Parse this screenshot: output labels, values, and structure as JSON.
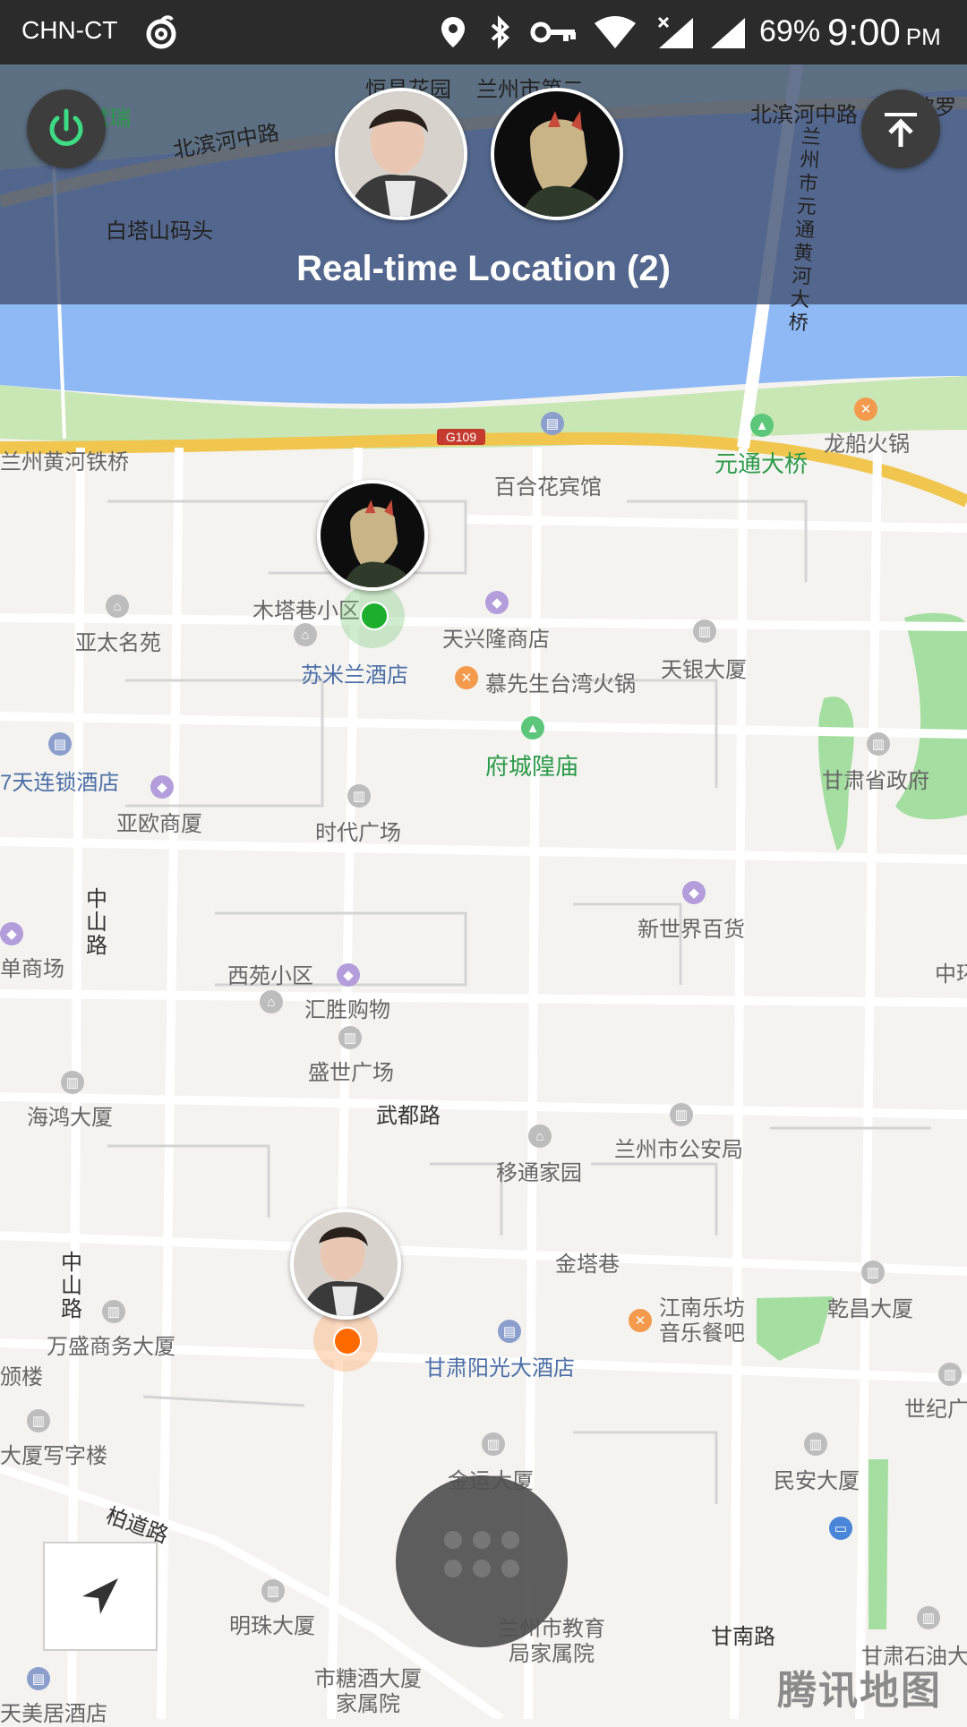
{
  "status_bar": {
    "carrier": "CHN-CT",
    "battery": "69%",
    "time": "9:00",
    "ampm": "PM"
  },
  "header": {
    "title": "Real-time Location (2)"
  },
  "map": {
    "watermark": "腾讯地图",
    "road_sign": "G109",
    "labels": {
      "l1": "兰州黄河铁桥",
      "l2": "百合花宾馆",
      "l3": "元通大桥",
      "l4": "龙船火锅",
      "l5": "木塔巷小区",
      "l6": "亚太名苑",
      "l7": "天兴隆商店",
      "l8": "苏米兰酒店",
      "l9": "慕先生台湾火锅",
      "l10": "天银大厦",
      "l11": "府城隍庙",
      "l12": "7天连锁酒店",
      "l13": "亚欧商厦",
      "l14": "时代广场",
      "l15": "甘肃省政府",
      "l16": "新世界百货",
      "l17": "中山路",
      "l18": "单商场",
      "l19": "西苑小区",
      "l20": "汇胜购物",
      "l21": "中环",
      "l22": "盛世广场",
      "l23": "海鸿大厦",
      "l24": "武都路",
      "l25": "兰州市公安局",
      "l26": "移通家园",
      "l27": "金塔巷",
      "l28": "中山路",
      "l29": "万盛商务大厦",
      "l30": "江南乐坊音乐餐吧",
      "l31": "乾昌大厦",
      "l32": "甘肃阳光大酒店",
      "l33": "颁楼",
      "l34": "世纪广",
      "l35": "大厦写字楼",
      "l36": "金运大厦",
      "l37": "民安大厦",
      "l38": "柏道路",
      "l39": "明珠大厦",
      "l40": "兰州市教育局家属院",
      "l41": "甘南路",
      "l42": "甘肃石油大",
      "l43": "市糖酒大厦家属院",
      "l44": "天美居酒店",
      "l45": "北滨河中路",
      "l46": "白塔山码头",
      "l47": "北滨河中路",
      "l48": "兰州市元通黄河大桥",
      "l49": "恒昌花园",
      "l50": "兰州市第二",
      "l51": "阿波罗",
      "l52": "献瑞"
    }
  },
  "buttons": {
    "power": "power",
    "collapse": "collapse"
  },
  "members": [
    {
      "name": "member-1"
    },
    {
      "name": "member-2"
    }
  ]
}
